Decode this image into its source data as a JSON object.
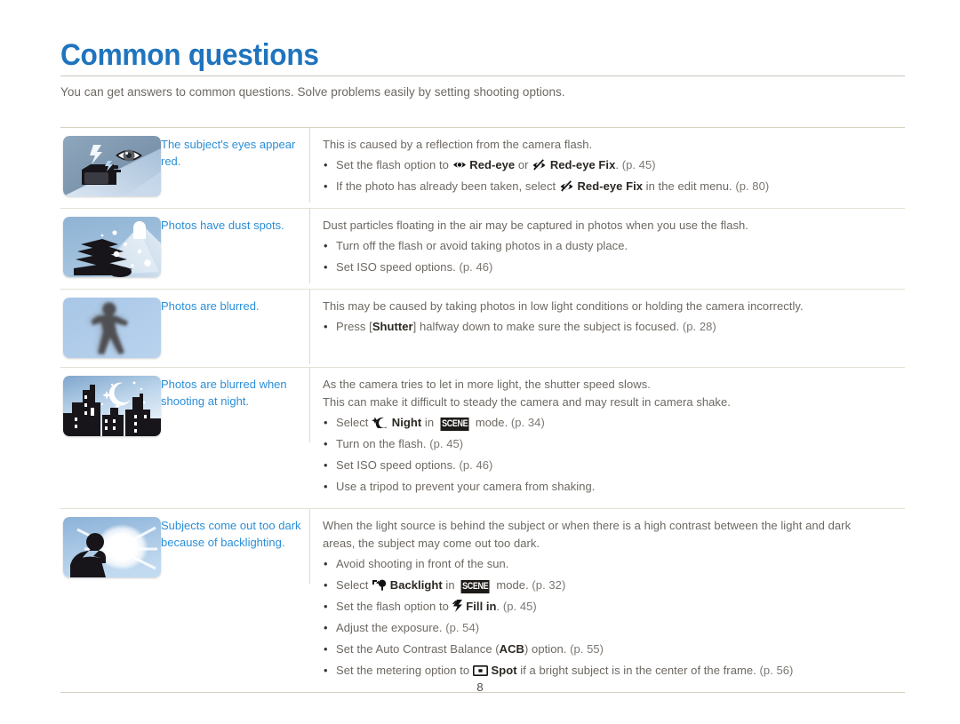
{
  "document": {
    "title": "Common questions",
    "intro": "You can get answers to common questions. Solve problems easily by setting shooting options.",
    "page_number": "8",
    "accent_color": "#1f74bd",
    "label_color": "#2b8fd8",
    "body_color": "#6d6862",
    "rule_color": "#d6d2bf"
  },
  "rows": [
    {
      "illustration_name": "red-eye-camera-flash-illustration",
      "label": "The subject's eyes appear red.",
      "lead": "This is caused by a reflection from the camera flash.",
      "bullets": [
        {
          "segments": [
            {
              "t": "text",
              "v": "Set the flash option to "
            },
            {
              "t": "icon",
              "v": "red-eye-icon"
            },
            {
              "t": "bold",
              "v": "Red-eye"
            },
            {
              "t": "text",
              "v": " or "
            },
            {
              "t": "icon",
              "v": "red-eye-fix-icon"
            },
            {
              "t": "bold",
              "v": "Red-eye Fix"
            },
            {
              "t": "text",
              "v": ". "
            },
            {
              "t": "page",
              "v": "(p. 45)"
            }
          ]
        },
        {
          "segments": [
            {
              "t": "text",
              "v": "If the photo has already been taken, select "
            },
            {
              "t": "icon",
              "v": "red-eye-fix-icon"
            },
            {
              "t": "bold",
              "v": "Red-eye Fix"
            },
            {
              "t": "text",
              "v": " in the edit menu. "
            },
            {
              "t": "page",
              "v": "(p. 80)"
            }
          ]
        }
      ]
    },
    {
      "illustration_name": "dust-spots-stack-illustration",
      "label": "Photos have dust spots.",
      "lead": "Dust particles floating in the air may be captured in photos when you use the flash.",
      "bullets": [
        {
          "segments": [
            {
              "t": "text",
              "v": "Turn off the flash or avoid taking photos in a dusty place."
            }
          ]
        },
        {
          "segments": [
            {
              "t": "text",
              "v": "Set ISO speed options. "
            },
            {
              "t": "page",
              "v": "(p. 46)"
            }
          ]
        }
      ]
    },
    {
      "illustration_name": "blurred-person-illustration",
      "label": "Photos are blurred.",
      "lead": "This may be caused by taking photos in low light conditions or holding the camera incorrectly.",
      "bullets": [
        {
          "segments": [
            {
              "t": "text",
              "v": "Press ["
            },
            {
              "t": "bold",
              "v": "Shutter"
            },
            {
              "t": "text",
              "v": "] halfway down to make sure the subject is focused. "
            },
            {
              "t": "page",
              "v": "(p. 28)"
            }
          ]
        }
      ]
    },
    {
      "illustration_name": "night-cityscape-illustration",
      "label": "Photos are blurred when shooting at night.",
      "lead": "As the camera tries to let in more light, the shutter speed slows.",
      "lead2": "This can make it difficult to steady the camera and may result in camera shake.",
      "bullets": [
        {
          "segments": [
            {
              "t": "text",
              "v": "Select "
            },
            {
              "t": "icon",
              "v": "night-mode-icon"
            },
            {
              "t": "bold",
              "v": "Night"
            },
            {
              "t": "text",
              "v": " in "
            },
            {
              "t": "chip",
              "v": "SCENE"
            },
            {
              "t": "text",
              "v": " mode. "
            },
            {
              "t": "page",
              "v": "(p. 34)"
            }
          ]
        },
        {
          "segments": [
            {
              "t": "text",
              "v": "Turn on the flash. "
            },
            {
              "t": "page",
              "v": "(p. 45)"
            }
          ]
        },
        {
          "segments": [
            {
              "t": "text",
              "v": "Set ISO speed options. "
            },
            {
              "t": "page",
              "v": "(p. 46)"
            }
          ]
        },
        {
          "segments": [
            {
              "t": "text",
              "v": "Use a tripod to prevent your camera from shaking."
            }
          ]
        }
      ]
    },
    {
      "illustration_name": "backlighting-silhouette-sun-illustration",
      "label": "Subjects come out too dark because of backlighting.",
      "lead": "When the light source is behind the subject or when there is a high contrast between the light and dark",
      "lead2": "areas, the subject may come out too dark.",
      "bullets": [
        {
          "segments": [
            {
              "t": "text",
              "v": "Avoid shooting in front of the sun."
            }
          ]
        },
        {
          "segments": [
            {
              "t": "text",
              "v": "Select "
            },
            {
              "t": "icon",
              "v": "backlight-mode-icon"
            },
            {
              "t": "bold",
              "v": "Backlight"
            },
            {
              "t": "text",
              "v": " in "
            },
            {
              "t": "chip",
              "v": "SCENE"
            },
            {
              "t": "text",
              "v": " mode. "
            },
            {
              "t": "page",
              "v": "(p. 32)"
            }
          ]
        },
        {
          "segments": [
            {
              "t": "text",
              "v": "Set the flash option to "
            },
            {
              "t": "icon",
              "v": "fill-in-flash-icon"
            },
            {
              "t": "bold",
              "v": "Fill in"
            },
            {
              "t": "text",
              "v": ". "
            },
            {
              "t": "page",
              "v": "(p. 45)"
            }
          ]
        },
        {
          "segments": [
            {
              "t": "text",
              "v": "Adjust the exposure. "
            },
            {
              "t": "page",
              "v": "(p. 54)"
            }
          ]
        },
        {
          "segments": [
            {
              "t": "text",
              "v": "Set the Auto Contrast Balance ("
            },
            {
              "t": "bold",
              "v": "ACB"
            },
            {
              "t": "text",
              "v": ") option. "
            },
            {
              "t": "page",
              "v": "(p. 55)"
            }
          ]
        },
        {
          "segments": [
            {
              "t": "text",
              "v": "Set the metering option to "
            },
            {
              "t": "icon",
              "v": "spot-metering-icon"
            },
            {
              "t": "bold",
              "v": "Spot"
            },
            {
              "t": "text",
              "v": " if a bright subject is in the center of the frame. "
            },
            {
              "t": "page",
              "v": "(p. 56)"
            }
          ]
        }
      ]
    }
  ]
}
